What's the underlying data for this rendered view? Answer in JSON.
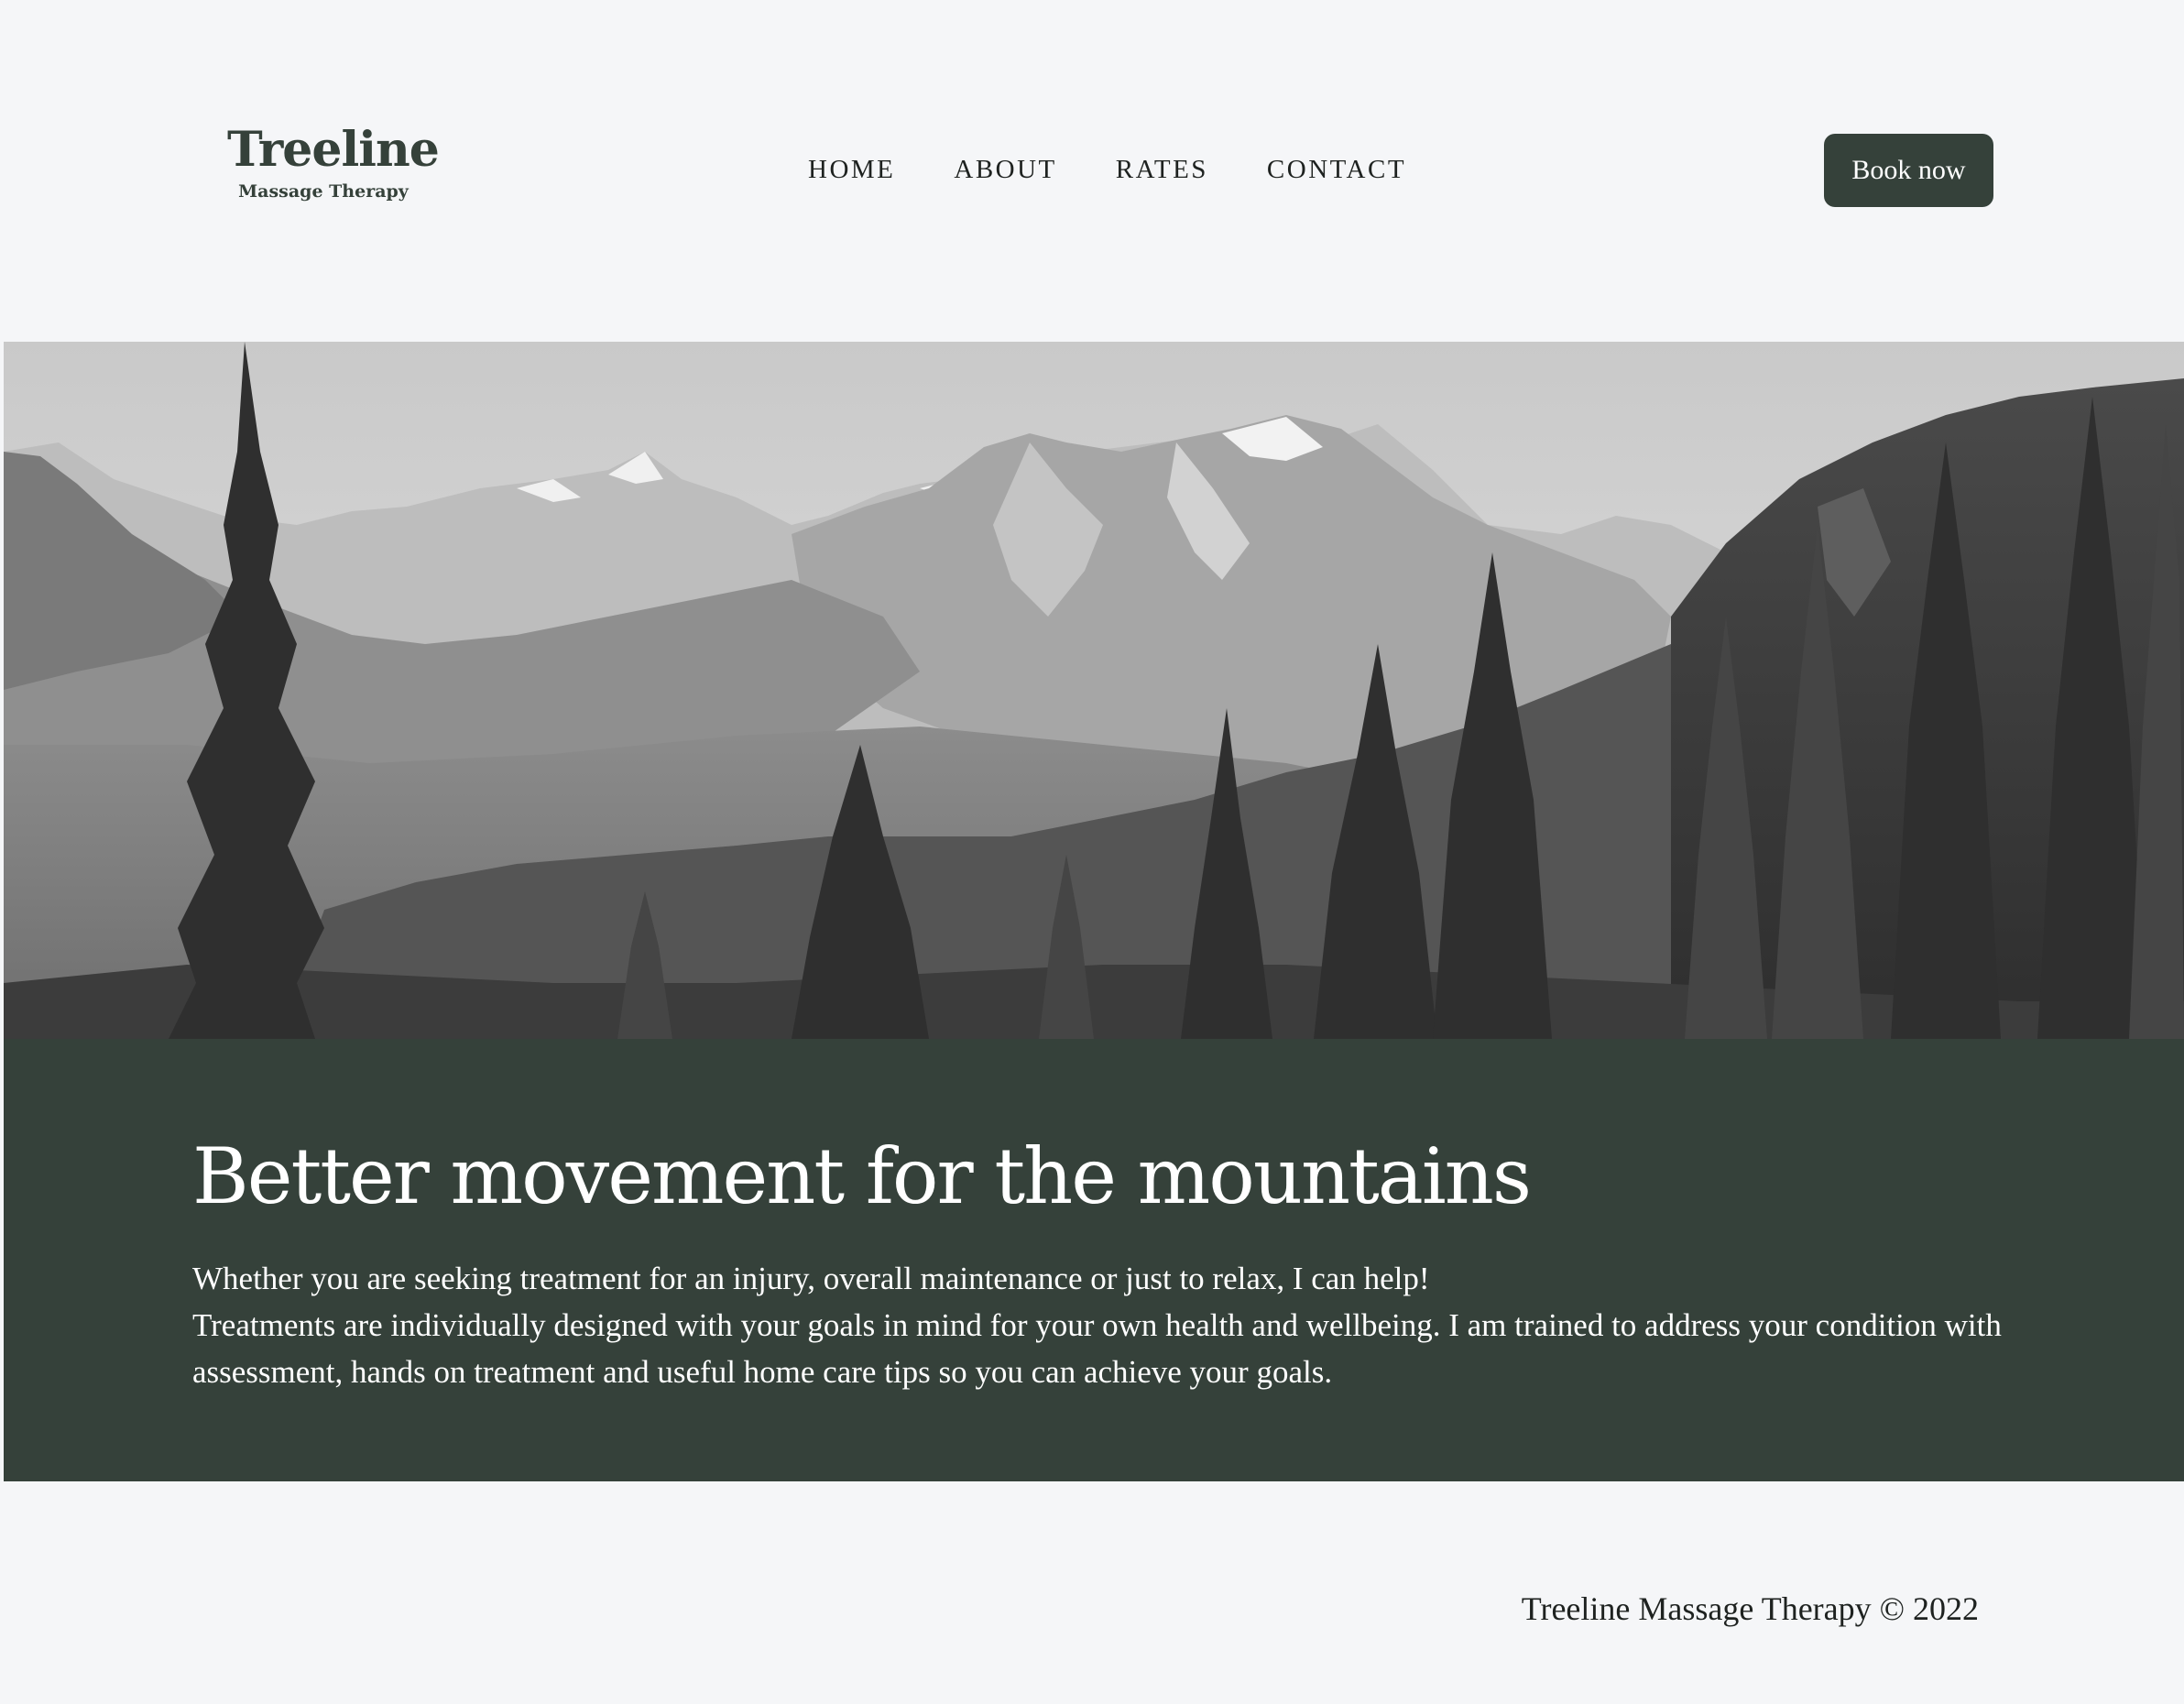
{
  "brand": {
    "name": "Treeline",
    "tagline": "Massage Therapy",
    "primary_color": "#35413a",
    "background_color": "#f5f6f8"
  },
  "nav": {
    "items": [
      {
        "label": "HOME"
      },
      {
        "label": "ABOUT"
      },
      {
        "label": "RATES"
      },
      {
        "label": "CONTACT"
      }
    ]
  },
  "header": {
    "book_label": "Book now"
  },
  "hero": {
    "image": "mountain-forest-landscape"
  },
  "intro": {
    "heading": "Better movement for the mountains",
    "paragraph_1": "Whether you are seeking treatment for an injury, overall maintenance or just to relax, I can help!",
    "paragraph_2": "Treatments are individually designed with your goals in mind for your own health and wellbeing. I am trained to address your condition with assessment, hands on treatment and useful home care tips so you can achieve your goals."
  },
  "footer": {
    "copyright": "Treeline Massage Therapy © 2022"
  }
}
